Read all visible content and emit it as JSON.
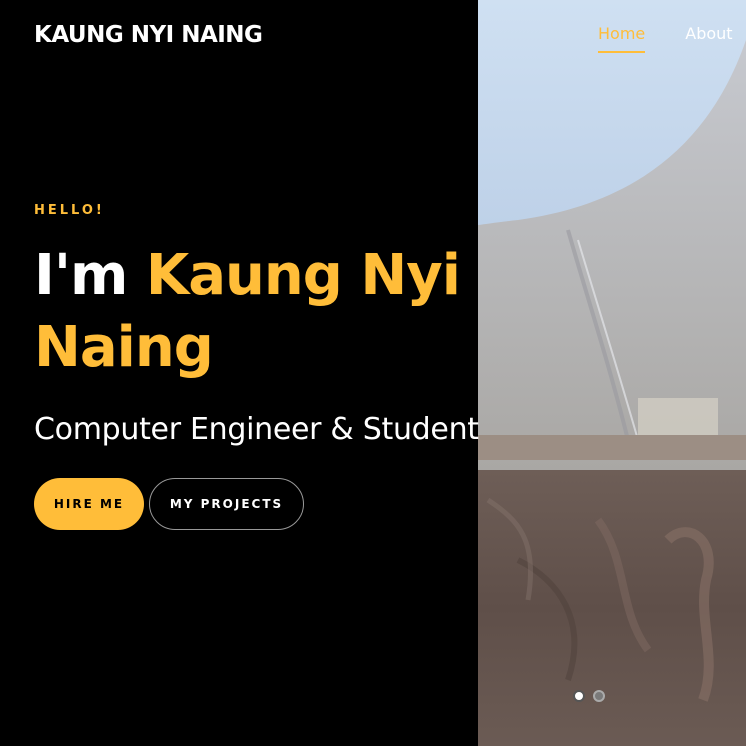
{
  "header": {
    "brand": "KAUNG NYI NAING",
    "nav": [
      {
        "label": "Home",
        "active": true
      },
      {
        "label": "About",
        "active": false
      }
    ]
  },
  "hero": {
    "greeting": "HELLO!",
    "headline_prefix": "I'm ",
    "headline_name": "Kaung Nyi Naing",
    "subtitle": "Computer Engineer & Student",
    "buttons": {
      "hire": "HIRE ME",
      "projects": "MY PROJECTS"
    }
  },
  "carousel": {
    "slide_count": 2,
    "active_index": 0
  },
  "colors": {
    "accent": "#ffbd39",
    "background": "#000000",
    "text": "#ffffff"
  }
}
